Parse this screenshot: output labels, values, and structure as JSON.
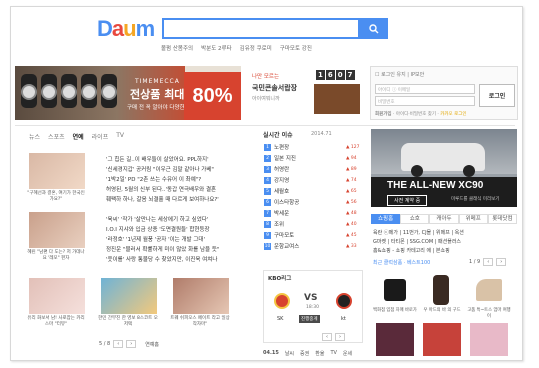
{
  "logo": {
    "letters": [
      "D",
      "a",
      "u",
      "m"
    ]
  },
  "search": {
    "placeholder": ""
  },
  "topnav": {
    "items": [
      "볼펌 산봄주의",
      "박분도 2루타",
      "김유정 쿠로미",
      "구마모토 강진"
    ]
  },
  "banner": {
    "brand": "TIMEMECCA",
    "headline": "전상품 최대",
    "percent": "80%",
    "sub": "구매 전 꼭 알아야 다양한 상품 대기중"
  },
  "ad2": {
    "tag": "나만 모르는",
    "title": "국민콘솔서랍장",
    "sub": "아이여뭐니까",
    "clock": [
      "1",
      "6",
      "0",
      "7"
    ]
  },
  "login": {
    "option1": "로그인 유지",
    "option2": "IP보안",
    "id_placeholder": "아이디 ⓘ 이메일",
    "pw_placeholder": "비밀번호",
    "button": "로그인",
    "foot1": "회원가입",
    "foot2": "아이디·비밀번호 찾기",
    "foot3": "카카오 로그인"
  },
  "tabs": [
    "뉴스",
    "스포츠",
    "연예",
    "라이프",
    "TV"
  ],
  "active_tab": "연예",
  "news": {
    "captions": [
      "\"구혜선과 결혼, 여기가 한국인가요?\"",
      "혜린 \"남편 다 도는? 저 가데나요 '레모\" 펀자",
      "유리 화보서 남! 사로잡는 카리스마 \"터뷰\"",
      "한민 간부진 한 영보 8스코트 오저택",
      "트퀘 쉬피오스 페이트 라고 일상 작자마\""
    ],
    "headlines": [
      "'그 힙든 길..이 배우들이 살았어요. PPL하지'",
      "'신세경지갑' 공커림 \"이우근 김말 같아나 가베\"",
      "'1박2일' PD \"2촌 쓰는 수유어 이 촤예\"?",
      "허영된, 5월의 신부 된다..'동갑 연극배우와 결혼",
      "훼팩하 하나, 갈음 뇌결흘 때 다르게 보여하나요?'",
      "'육씨' '작가 '살만나는 세상에기 하고 싶었다'",
      "I.O.I 지샤와 입금 상종 '도면결원들' 합현등장",
      "'라정호' '1년제 월풍 '공자 '이는 개발 그대'",
      "정진운 \"블러서 확률하게 미이 않았 화를 남을 듯\"",
      "'웃이를' 사랑 통물당 수 찾았지만, 이진욱 여쳐나"
    ],
    "pager": "5 / 8",
    "more": "연예홈"
  },
  "ranking": {
    "title": "실시간 이슈",
    "date": "2014.71",
    "items": [
      {
        "rank": "1",
        "text": "노편장",
        "delta": "▲ 127"
      },
      {
        "rank": "2",
        "text": "일본 지진",
        "delta": "▲ 94"
      },
      {
        "rank": "3",
        "text": "허영란",
        "delta": "▲ 89"
      },
      {
        "rank": "4",
        "text": "강지영",
        "delta": "▲ 74"
      },
      {
        "rank": "5",
        "text": "세월호",
        "delta": "▲ 65"
      },
      {
        "rank": "6",
        "text": "이스타항공",
        "delta": "▲ 56"
      },
      {
        "rank": "7",
        "text": "박세운",
        "delta": "▲ 48"
      },
      {
        "rank": "8",
        "text": "조위",
        "delta": "▲ 40"
      },
      {
        "rank": "9",
        "text": "구마모토",
        "delta": "▲ 45"
      },
      {
        "rank": "10",
        "text": "운항교여스",
        "delta": "▲ 33"
      }
    ]
  },
  "kbo": {
    "title": "KBO리그",
    "score": "VS",
    "time": "18:30",
    "team1": "SK",
    "team2": "kt",
    "status": "진행중게"
  },
  "weather": {
    "date": "04.15",
    "items": [
      "날씨",
      "증권",
      "환율",
      "TV",
      "운세"
    ]
  },
  "xc90": {
    "title": "THE ALL-NEW XC90",
    "button": "사전 계약 중",
    "sub": "미루드를 클래식 미리보기"
  },
  "shop": {
    "tabs": [
      "쇼핑홈",
      "쇼호",
      "캐아두",
      "위메프",
      "롯데닷컴"
    ],
    "active": "쇼핑홈",
    "line1": "육란 ⓒ메가 | 11번가, CJ몰 | 위메프 | 옥션",
    "line2": "G마켓 | 타티몬 | SSG.COM | 패션플러스",
    "line3": "홈&쇼핑 - 쇼핑 카테고리 에 | 본쇼핑",
    "label": "최근 클럭삼품 · 베스트100",
    "page": "1 / 9",
    "captions": [
      "백화점 입점 자매 바로가",
      "우 아드의 바 의 구드",
      "고품 특~트스 엄마 여행 이",
      "",
      "",
      ""
    ]
  }
}
